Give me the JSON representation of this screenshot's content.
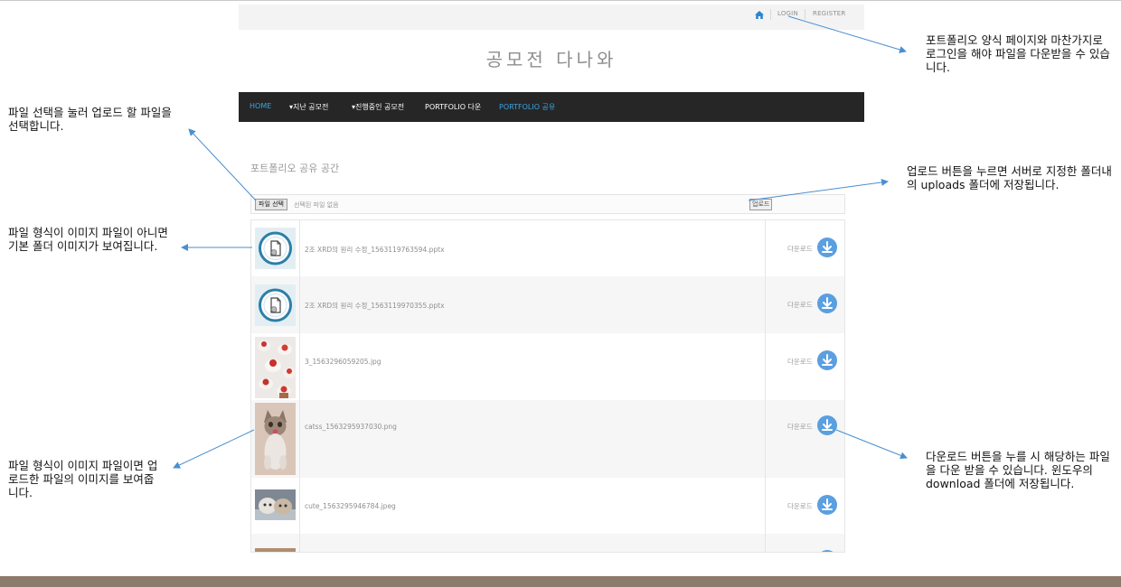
{
  "topbar": {
    "login_label": "LOGIN",
    "register_label": "REGISTER"
  },
  "site": {
    "title": "공모전 다나와"
  },
  "nav": {
    "items": [
      {
        "label": "HOME"
      },
      {
        "label": "▾지난 공모전"
      },
      {
        "label": "▾진행중인 공모전"
      },
      {
        "label": "PORTFOLIO 다운"
      },
      {
        "label": "PORTFOLIO 공유"
      }
    ]
  },
  "main": {
    "section_title": "포트폴리오 공유 공간",
    "file_button_label": "파일 선택",
    "file_status": "선택된 파일 없음",
    "upload_button_label": "업로드",
    "download_label": "다운로드",
    "files": [
      {
        "name": "2조 XRD의 원리 수정_1563119763594.pptx",
        "thumb": "folder-icon"
      },
      {
        "name": "2조 XRD의 원리 수정_1563119970355.pptx",
        "thumb": "folder-icon"
      },
      {
        "name": "3_1563296059205.jpg",
        "thumb": "cupcakes-photo"
      },
      {
        "name": "catss_1563295937030.png",
        "thumb": "kitten-photo"
      },
      {
        "name": "cute_1563295946784.jpeg",
        "thumb": "kittens-photo"
      }
    ]
  },
  "annotations": {
    "login_note": "포트폴리오 양식 페이지와 마찬가지로 로그인을 해야 파일을 다운받을 수 있습니다.",
    "select_note": "파일 선택을 눌러 업로드 할 파일을 선택합니다.",
    "upload_note": "업로드 버튼을 누르면 서버로 지정한 폴더내의 uploads 폴더에 저장됩니다.",
    "non_image_note": "파일 형식이 이미지 파일이 아니면 기본 폴더 이미지가 보여집니다.",
    "image_note": "파일 형식이 이미지 파일이면 업로드한 파일의 이미지를 보여줍니다.",
    "download_note": "다운로드 버튼을 누를 시 해당하는 파일을 다운 받을 수 있습니다. 윈도우의 download 폴더에 저장됩니다."
  },
  "colors": {
    "nav_background": "#262626",
    "nav_active": "#35a6e6",
    "download_icon": "#5a9fe0",
    "arrow": "#4a8fd0",
    "bottom_band": "#8c7a6c"
  }
}
